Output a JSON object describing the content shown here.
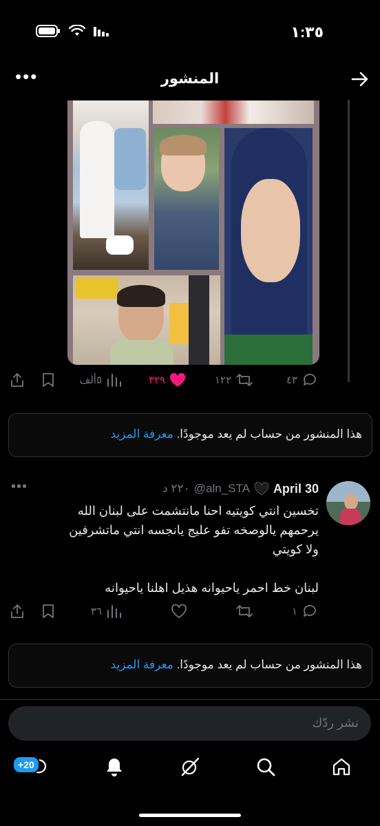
{
  "status_bar": {
    "time": "١:٣٥"
  },
  "header": {
    "title": "المنشور"
  },
  "post_actions": {
    "replies": "٤٣",
    "reposts": "١٢٢",
    "likes": "٣٢٩",
    "views": "٥ألف"
  },
  "notice_1": {
    "text": "هذا المنشور من حساب لم يعد موجودًا.",
    "link": "معرفة المزيد"
  },
  "reply_tweet": {
    "name": "30 April",
    "handle": "@aln_STA",
    "time": "٢٢٠ د",
    "lines": [
      "تخسين انتي كويتيه احنا مانتشمت على لبنان الله",
      "يرحمهم يالوصخه  تفو عليج يانجسه انتي ماتشرفين",
      "ولا كويتي",
      "",
      "لبنان خط احمر ياحيوانه هذيل اهلنا ياحيوانه"
    ],
    "replies": "١",
    "views": "٣٦"
  },
  "notice_2": {
    "text": "هذا المنشور من حساب لم يعد موجودًا.",
    "link": "معرفة المزيد"
  },
  "reply_bar": {
    "placeholder": "نشر ردّك"
  },
  "nav": {
    "messages_badge": "+20"
  },
  "colors": {
    "accent": "#1d9bf0",
    "like": "#f91880",
    "muted": "#71767b",
    "background": "#000000"
  }
}
